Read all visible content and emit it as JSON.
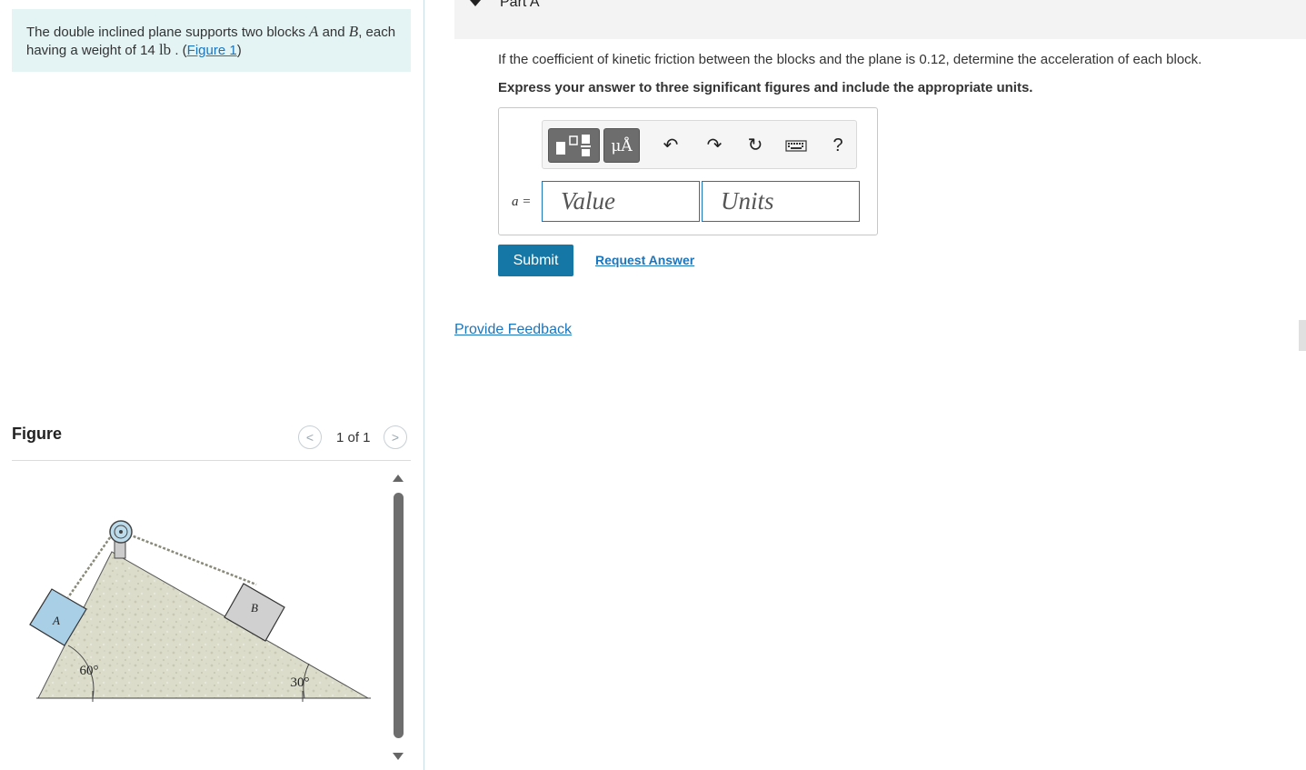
{
  "problem": {
    "text_before": "The double inclined plane supports two blocks ",
    "block_a": "A",
    "and": " and ",
    "block_b": "B",
    "text_mid": ", each having a weight of 14 ",
    "unit": "lb",
    "text_after": " . (",
    "figure_link": "Figure 1",
    "close": ")"
  },
  "figure_panel": {
    "title": "Figure",
    "pager": "1 of 1",
    "prev_icon": "chevron-left-icon",
    "next_icon": "chevron-right-icon",
    "labels": {
      "block_a": "A",
      "block_b": "B",
      "angle_left": "60°",
      "angle_right": "30°"
    }
  },
  "part": {
    "title": "Part A",
    "question": "If the coefficient of kinetic friction between the blocks and the plane is 0.12, determine the acceleration of each block.",
    "instructions": "Express your answer to three significant figures and include the appropriate units."
  },
  "answer": {
    "variable": "a =",
    "value_placeholder": "Value",
    "units_placeholder": "Units",
    "toolbar": {
      "templates_icon": "templates-icon",
      "units_label": "μÅ",
      "undo_icon": "↶",
      "redo_icon": "↷",
      "reset_icon": "↻",
      "keyboard_icon": "keyboard-icon",
      "help_label": "?"
    }
  },
  "actions": {
    "submit": "Submit",
    "request_answer": "Request Answer",
    "feedback": "Provide Feedback"
  },
  "colors": {
    "accent": "#1477a6",
    "link": "#1b75bc",
    "problem_bg": "#e4f4f4",
    "block_a_fill": "#a9cfe6",
    "block_b_fill": "#d0d0d0"
  }
}
